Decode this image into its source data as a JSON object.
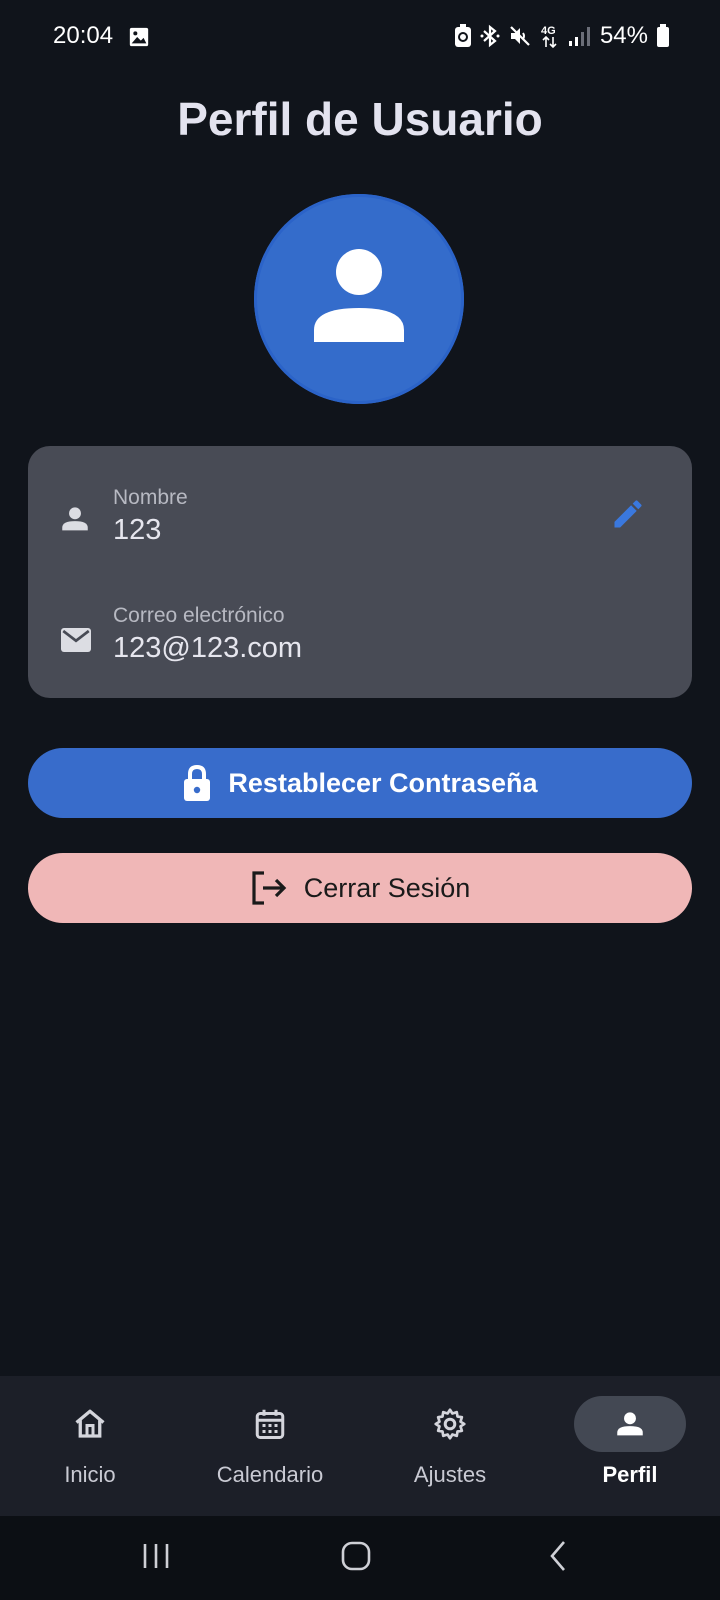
{
  "status_bar": {
    "time": "20:04",
    "battery_percent": "54%",
    "network": "4G",
    "icons": [
      "gallery-icon",
      "battery-saver-icon",
      "bluetooth-icon",
      "mute-icon",
      "network-4g-icon",
      "signal-icon",
      "battery-icon"
    ]
  },
  "header": {
    "title": "Perfil de Usuario"
  },
  "profile": {
    "avatar_icon": "person-icon",
    "name_label": "Nombre",
    "name_value": "123",
    "email_label": "Correo electrónico",
    "email_value": "123@123.com"
  },
  "actions": {
    "reset_password_label": "Restablecer Contraseña",
    "logout_label": "Cerrar Sesión"
  },
  "bottom_nav": {
    "items": [
      {
        "label": "Inicio",
        "icon": "home-icon",
        "active": false
      },
      {
        "label": "Calendario",
        "icon": "calendar-icon",
        "active": false
      },
      {
        "label": "Ajustes",
        "icon": "gear-icon",
        "active": false
      },
      {
        "label": "Perfil",
        "icon": "person-icon",
        "active": true
      }
    ]
  },
  "colors": {
    "background": "#10141b",
    "accent_blue": "#386ccb",
    "card": "#484b55",
    "logout": "#f0b7b7",
    "nav_bar": "#1c1f28"
  }
}
